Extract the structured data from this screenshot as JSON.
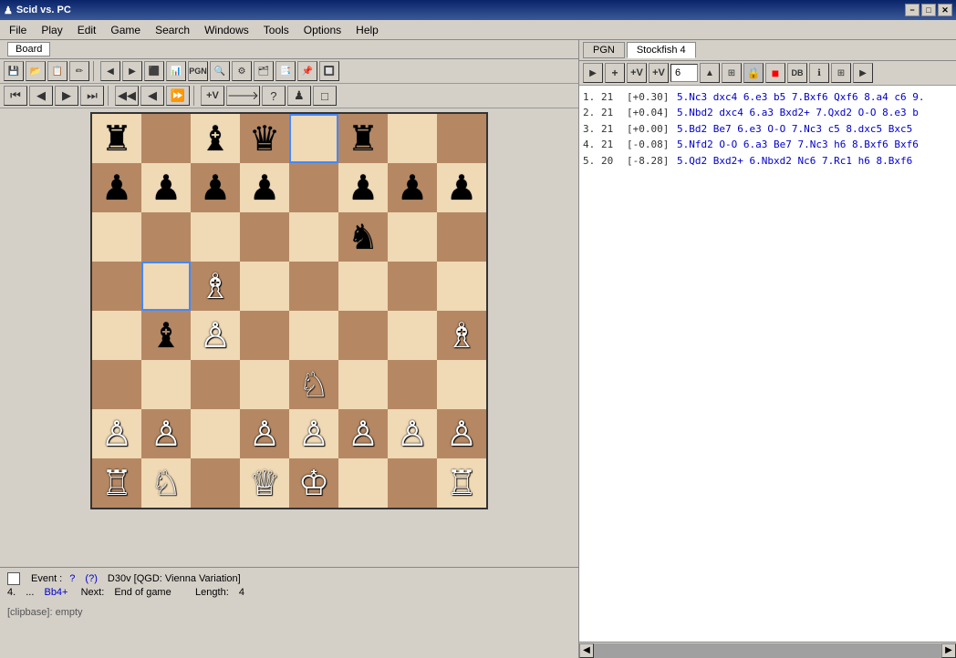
{
  "window": {
    "title": "Scid vs. PC",
    "icon": "♟"
  },
  "titlebar": {
    "min": "−",
    "max": "□",
    "close": "✕"
  },
  "menu": {
    "items": [
      "File",
      "Play",
      "Edit",
      "Game",
      "Search",
      "Windows",
      "Tools",
      "Options",
      "Help"
    ]
  },
  "left_panel": {
    "board_tab": "Board",
    "toolbar1": {
      "buttons": [
        "💾",
        "📂",
        "📋",
        "📝",
        "◀",
        "▶",
        "⬛",
        "📊",
        "PGN",
        "🔍",
        "⚙",
        "🗂",
        "📑",
        "📌",
        "🔲"
      ]
    },
    "toolbar2": {
      "nav": [
        "⏮",
        "◀",
        "▶",
        "⏭"
      ],
      "extra": [
        "◀◀",
        "◀",
        "⏩",
        "🔁",
        "❓",
        "♟",
        "□"
      ]
    }
  },
  "board": {
    "pieces": [
      [
        "r",
        "",
        "b",
        "q",
        "",
        "r",
        "",
        ""
      ],
      [
        "p",
        "p",
        "p",
        "p",
        "",
        "p",
        "p",
        "p"
      ],
      [
        "",
        "",
        "",
        "",
        "",
        "n",
        "",
        ""
      ],
      [
        "",
        "",
        "B",
        "",
        "",
        "",
        "",
        ""
      ],
      [
        "",
        "b",
        "P",
        "",
        "",
        "",
        "",
        "B"
      ],
      [
        "",
        "",
        "",
        "",
        "N",
        "",
        "",
        ""
      ],
      [
        "P",
        "P",
        "",
        "P",
        "P",
        "P",
        "P",
        "P"
      ],
      [
        "R",
        "N",
        "",
        "Q",
        "K",
        "",
        "",
        "R"
      ]
    ],
    "highlight_squares": [
      [
        0,
        4
      ],
      [
        3,
        1
      ]
    ],
    "colors": {
      "light": "#f0d9b5",
      "dark": "#b58863",
      "highlight": "#4488ff"
    }
  },
  "board_info": {
    "small_checkbox_label": "",
    "event_label": "Event :",
    "event_value": "?",
    "event_q": "(?)",
    "opening": "D30v [QGD: Vienna Variation]",
    "move_num": "4.",
    "ellipsis": "...",
    "move": "Bb4+",
    "next_label": "Next:",
    "next_value": "End of game",
    "length_label": "Length:",
    "length_value": "4",
    "clipbase": "[clipbase]:  empty"
  },
  "right_panel": {
    "tabs": [
      "PGN",
      "Stockfish 4"
    ],
    "active_tab": "Stockfish 4",
    "toolbar": {
      "play": "▶",
      "plus": "+",
      "plusV": "+V",
      "plusVV": "+V",
      "depth_label": "6",
      "info_btn": "🔒",
      "stop": "■",
      "db": "DB",
      "info": "ℹ",
      "extra": "⊞",
      "arrow": "▶"
    },
    "analysis_lines": [
      {
        "num": "1.",
        "depth": "21",
        "score": "[+0.30]",
        "moves": "5.Nc3 dxc4 6.e3 b5 7.Bxf6 Qxf6 8.a4 c6 9."
      },
      {
        "num": "2.",
        "depth": "21",
        "score": "[+0.04]",
        "moves": "5.Nbd2 dxc4 6.a3 Bxd2+ 7.Qxd2 O-O 8.e3 b"
      },
      {
        "num": "3.",
        "depth": "21",
        "score": "[+0.00]",
        "moves": "5.Bd2 Be7 6.e3 O-O 7.Nc3 c5 8.dxc5 Bxc5"
      },
      {
        "num": "4.",
        "depth": "21",
        "score": "[-0.08]",
        "moves": "5.Nfd2 O-O 6.a3 Be7 7.Nc3 h6 8.Bxf6 Bxf6"
      },
      {
        "num": "5.",
        "depth": "20",
        "score": "[-8.28]",
        "moves": "5.Qd2 Bxd2+ 6.Nbxd2 Nc6 7.Rc1 h6 8.Bxf6"
      }
    ]
  },
  "statusbar": {
    "clipbase": "[clipbase]:  empty"
  }
}
